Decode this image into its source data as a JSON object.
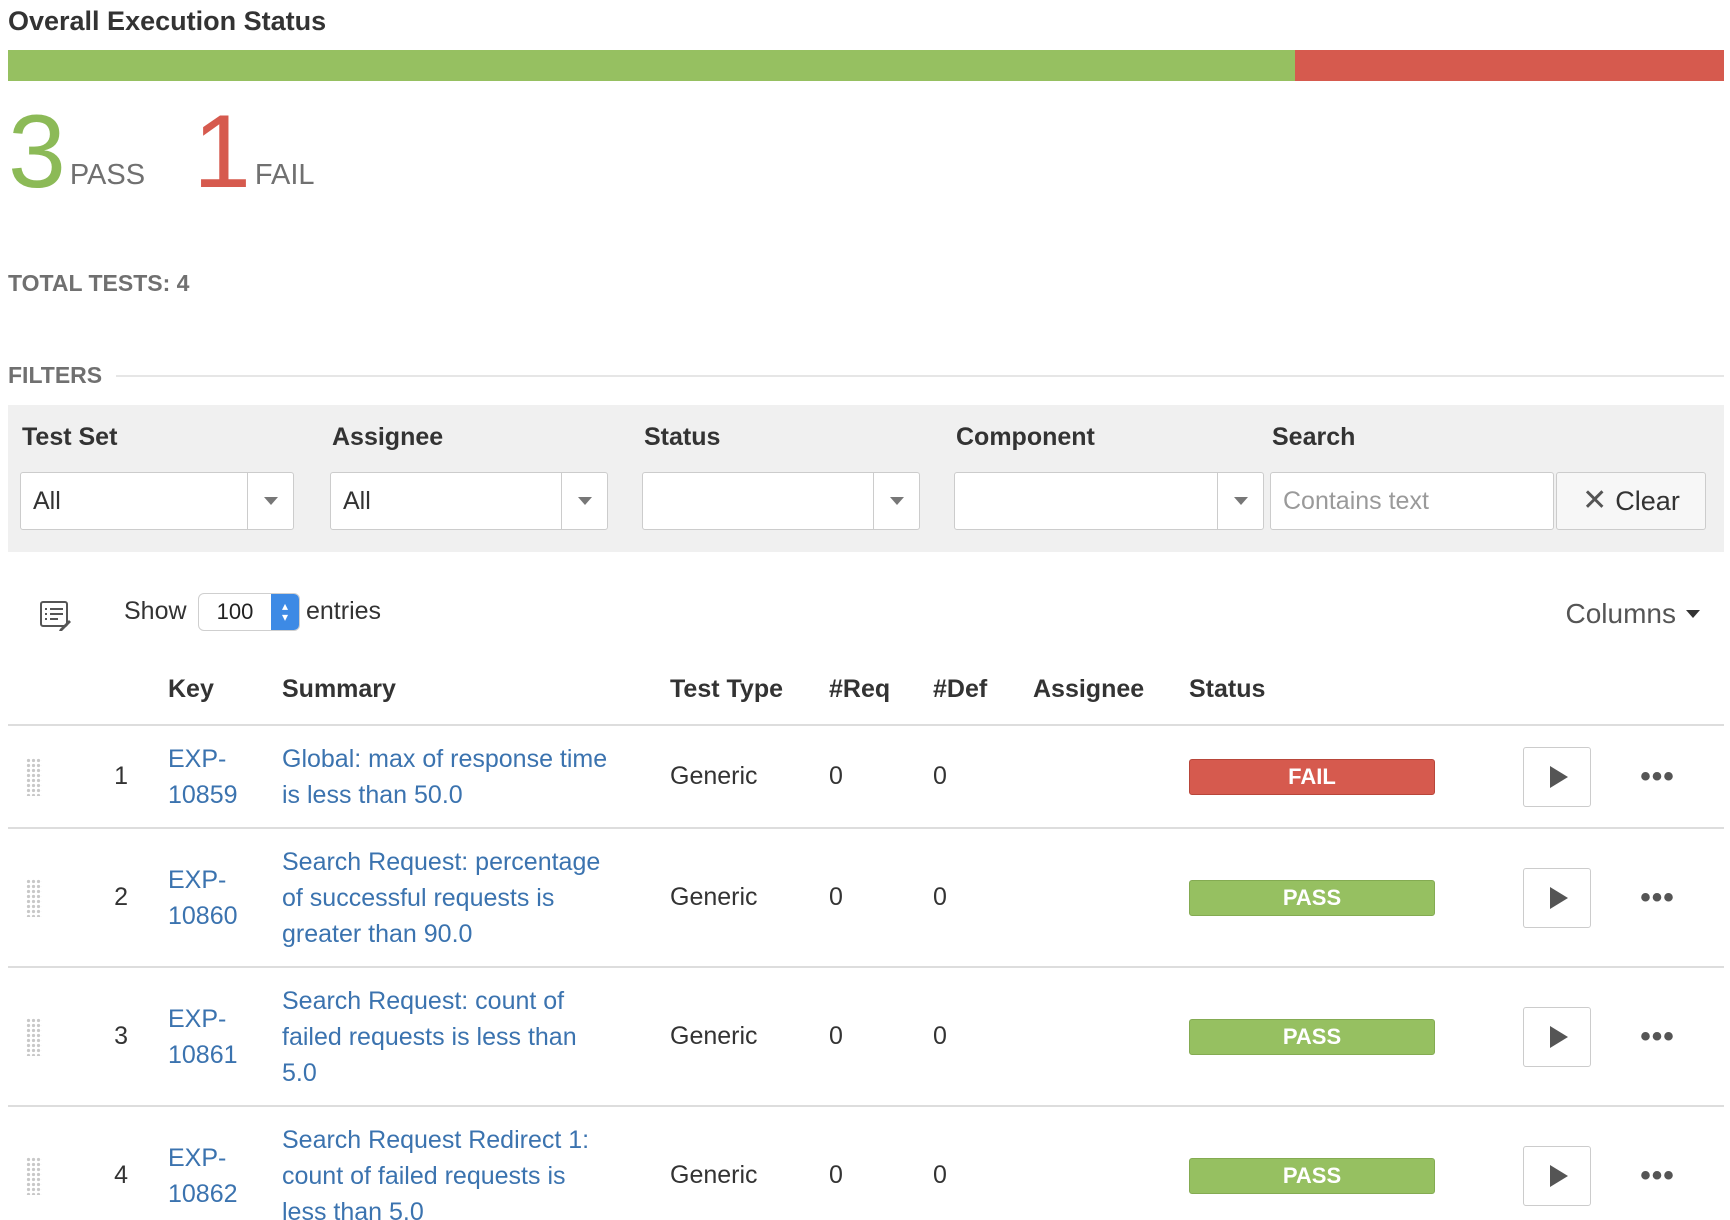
{
  "header": {
    "title": "Overall Execution Status"
  },
  "summary": {
    "pass_count": "3",
    "pass_label": "PASS",
    "fail_count": "1",
    "fail_label": "FAIL",
    "pass_fraction": 0.75,
    "fail_fraction": 0.25,
    "total_label": "TOTAL TESTS:",
    "total_value": "4"
  },
  "colors": {
    "pass": "#96c061",
    "fail": "#d65a4e",
    "link": "#3b73af"
  },
  "filters": {
    "heading": "FILTERS",
    "test_set": {
      "label": "Test Set",
      "value": "All"
    },
    "assignee": {
      "label": "Assignee",
      "value": "All"
    },
    "status": {
      "label": "Status",
      "value": ""
    },
    "component": {
      "label": "Component",
      "value": ""
    },
    "search": {
      "label": "Search",
      "value": "",
      "placeholder": "Contains text"
    },
    "clear_label": "Clear",
    "clear_icon": "close-x-icon"
  },
  "toolbar": {
    "list_icon": "list-edit-icon",
    "show_label": "Show",
    "entries_value": "100",
    "entries_label": "entries",
    "columns_label": "Columns"
  },
  "table": {
    "headers": {
      "key": "Key",
      "summary": "Summary",
      "test_type": "Test Type",
      "req": "#Req",
      "def": "#Def",
      "assignee": "Assignee",
      "status": "Status"
    },
    "rows": [
      {
        "num": "1",
        "key_prefix": "EXP-",
        "key_number": "10859",
        "summary_lines": [
          "Global: max of response time",
          "is less than 50.0",
          ""
        ],
        "test_type": "Generic",
        "req": "0",
        "def": "0",
        "assignee": "",
        "status": "FAIL"
      },
      {
        "num": "2",
        "key_prefix": "EXP-",
        "key_number": "10860",
        "summary_lines": [
          "Search Request: percentage",
          "of successful requests is",
          "greater than 90.0"
        ],
        "test_type": "Generic",
        "req": "0",
        "def": "0",
        "assignee": "",
        "status": "PASS"
      },
      {
        "num": "3",
        "key_prefix": "EXP-",
        "key_number": "10861",
        "summary_lines": [
          "Search Request: count of",
          "failed requests is less than",
          "5.0"
        ],
        "test_type": "Generic",
        "req": "0",
        "def": "0",
        "assignee": "",
        "status": "PASS"
      },
      {
        "num": "4",
        "key_prefix": "EXP-",
        "key_number": "10862",
        "summary_lines": [
          "Search Request Redirect 1:",
          "count of failed requests is",
          "less than 5.0"
        ],
        "test_type": "Generic",
        "req": "0",
        "def": "0",
        "assignee": "",
        "status": "PASS"
      }
    ],
    "run_icon": "play-icon",
    "more_icon": "ellipsis-icon",
    "more_glyph": "•••"
  }
}
